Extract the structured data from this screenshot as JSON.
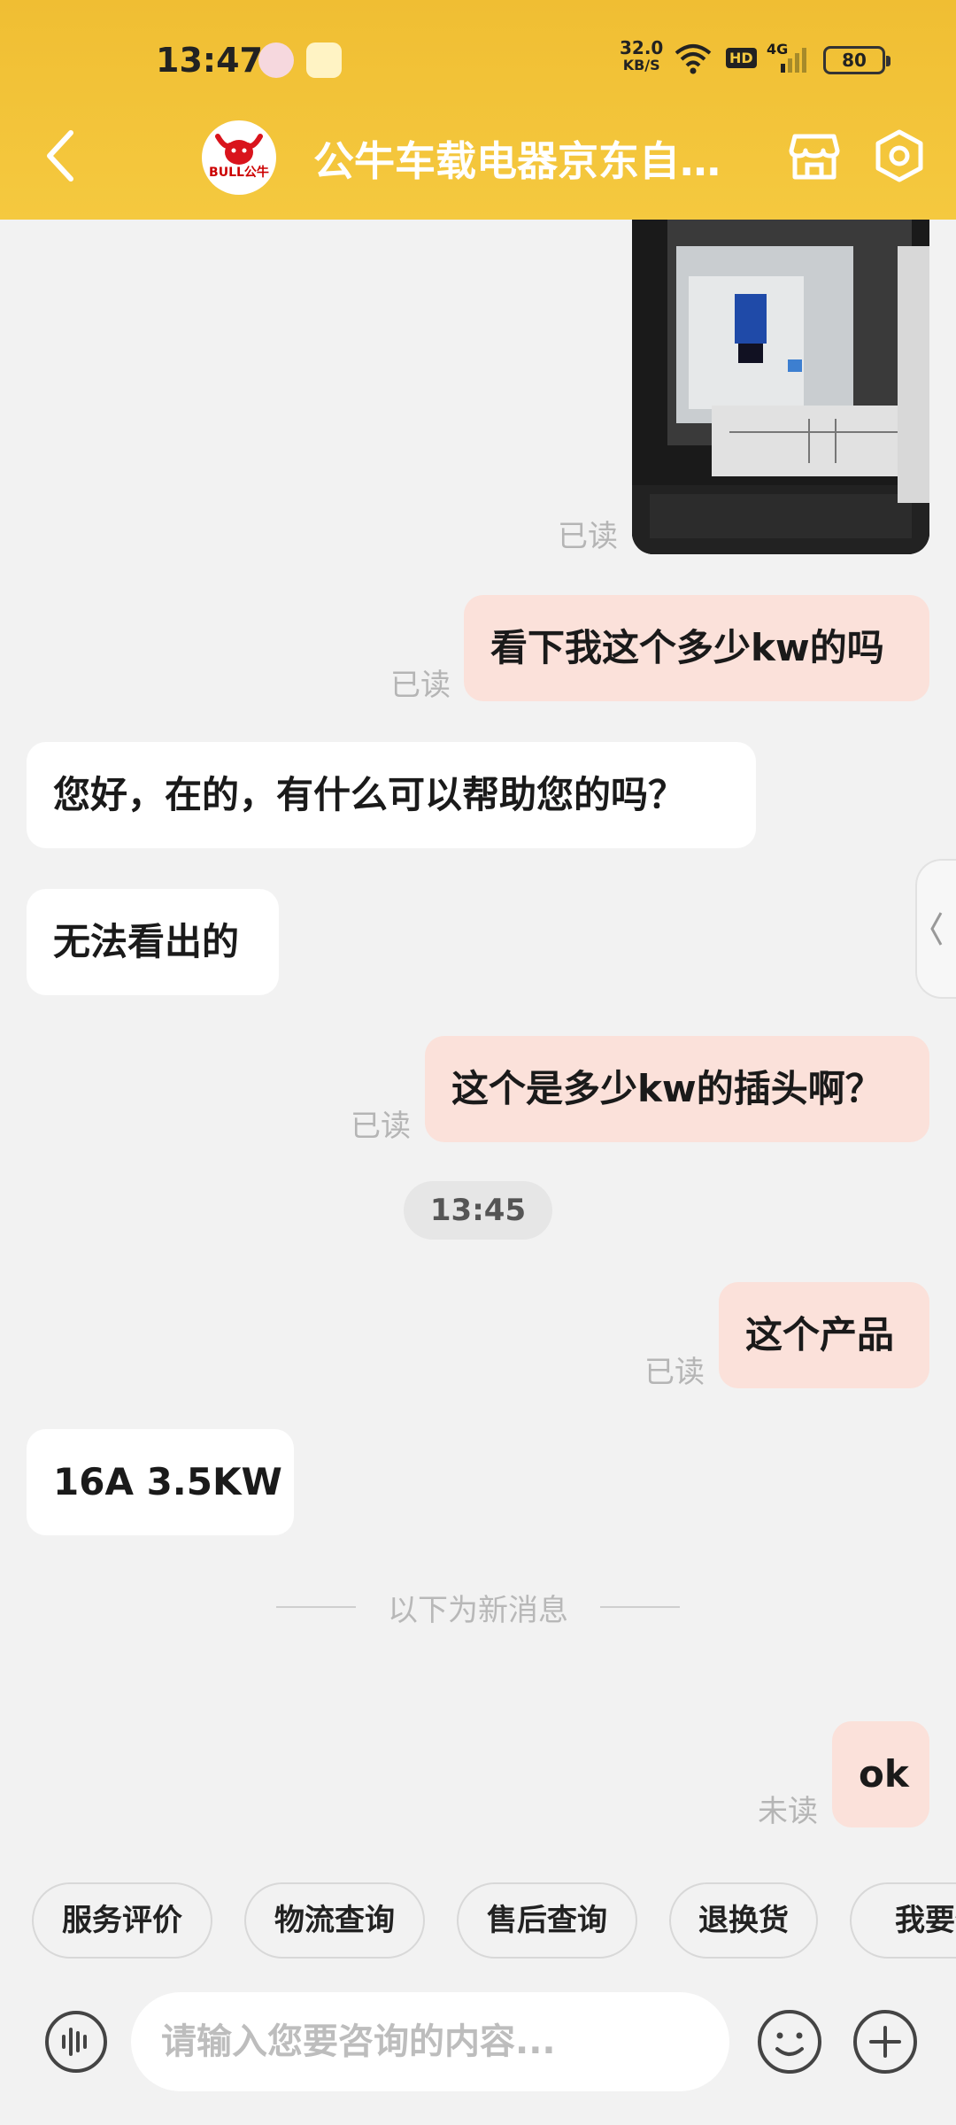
{
  "status_bar": {
    "time": "13:47",
    "net_speed": "32.0",
    "net_unit": "KB/S",
    "hd": "HD",
    "signal": "4G",
    "battery": "80"
  },
  "header": {
    "title": "公牛车载电器京东自…",
    "logo_text": "BULL公牛",
    "accent": "#f0be33"
  },
  "messages": {
    "m1_read": "已读",
    "m2": {
      "text": "看下我这个多少kw的吗",
      "status": "已读"
    },
    "m3": {
      "text": "您好，在的，有什么可以帮助您的吗？"
    },
    "m4": {
      "text": "无法看出的"
    },
    "m5": {
      "text": "这个是多少kw的插头啊？",
      "status": "已读"
    },
    "time_chip": "13:45",
    "m6": {
      "text": "这个产品",
      "status": "已读"
    },
    "m7": {
      "text": "16A  3.5KW"
    },
    "new_divider": "以下为新消息",
    "m8": {
      "text": "ok",
      "status": "未读"
    }
  },
  "quick_replies": [
    "服务评价",
    "物流查询",
    "售后查询",
    "退换货",
    "我要催"
  ],
  "input": {
    "placeholder": "请输入您要咨询的内容..."
  },
  "icons": {
    "back": "chevron-left-icon",
    "store": "store-icon",
    "settings": "settings-icon",
    "voice": "voice-icon",
    "emoji": "emoji-icon",
    "plus": "plus-icon"
  }
}
